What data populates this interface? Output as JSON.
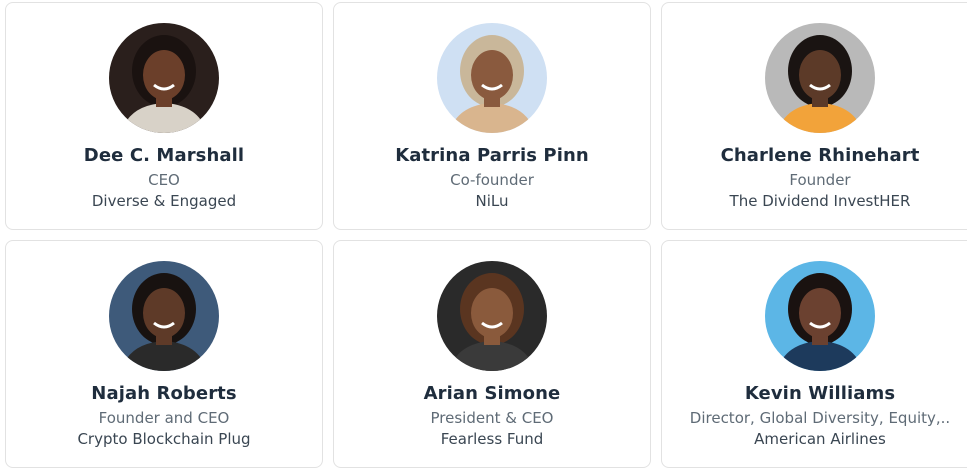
{
  "people": [
    {
      "name": "Dee C. Marshall",
      "title": "CEO",
      "company": "Diverse & Engaged",
      "avatar": {
        "icon": "person-photo-icon",
        "bg": "#2a1f1c",
        "skin": "#6b3f2a",
        "hair": "#1a1210",
        "shirt": "#d8d2c8"
      }
    },
    {
      "name": "Katrina Parris Pinn",
      "title": "Co-founder",
      "company": "NiLu",
      "avatar": {
        "icon": "person-photo-icon",
        "bg": "#cfe0f3",
        "skin": "#8a5a3e",
        "hair": "#c9b79a",
        "shirt": "#d9b58e"
      }
    },
    {
      "name": "Charlene Rhinehart",
      "title": "Founder",
      "company": "The Dividend InvestHER",
      "avatar": {
        "icon": "person-photo-icon",
        "bg": "#b9b9b9",
        "skin": "#5c3a28",
        "hair": "#1a1412",
        "shirt": "#f2a33a"
      }
    },
    {
      "name": "Najah Roberts",
      "title": "Founder and CEO",
      "company": "Crypto Blockchain Plug",
      "avatar": {
        "icon": "person-photo-icon",
        "bg": "#3e5a7a",
        "skin": "#5e3a28",
        "hair": "#181210",
        "shirt": "#2a2a2a"
      }
    },
    {
      "name": "Arian Simone",
      "title": "President & CEO",
      "company": "Fearless Fund",
      "avatar": {
        "icon": "person-photo-icon",
        "bg": "#2a2a2a",
        "skin": "#8a5a3c",
        "hair": "#5a3520",
        "shirt": "#3a3a3a"
      }
    },
    {
      "name": "Kevin Williams",
      "title": "Director, Global Diversity, Equity,..",
      "company": "American Airlines",
      "avatar": {
        "icon": "person-photo-icon",
        "bg": "#5cb6e6",
        "skin": "#6b4130",
        "hair": "#1a1210",
        "shirt": "#1d3a5c"
      }
    }
  ]
}
